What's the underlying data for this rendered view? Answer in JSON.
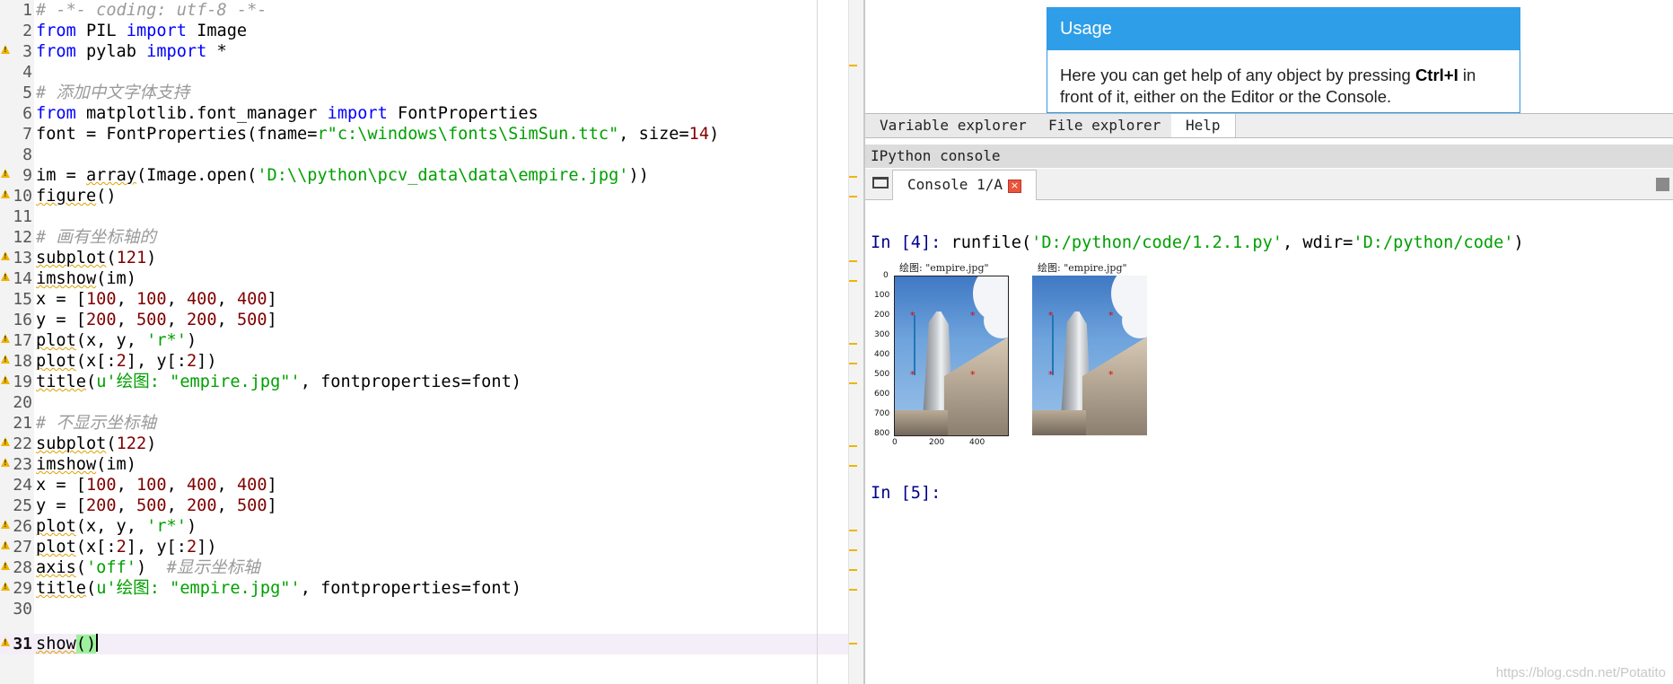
{
  "editor": {
    "lines": [
      {
        "n": "1",
        "w": false,
        "cur": false
      },
      {
        "n": "2",
        "w": false,
        "cur": false
      },
      {
        "n": "3",
        "w": true,
        "cur": false
      },
      {
        "n": "4",
        "w": false,
        "cur": false
      },
      {
        "n": "5",
        "w": false,
        "cur": false
      },
      {
        "n": "6",
        "w": false,
        "cur": false
      },
      {
        "n": "7",
        "w": false,
        "cur": false
      },
      {
        "n": "8",
        "w": false,
        "cur": false
      },
      {
        "n": "9",
        "w": true,
        "cur": false
      },
      {
        "n": "10",
        "w": true,
        "cur": false
      },
      {
        "n": "11",
        "w": false,
        "cur": false
      },
      {
        "n": "12",
        "w": false,
        "cur": false
      },
      {
        "n": "13",
        "w": true,
        "cur": false
      },
      {
        "n": "14",
        "w": true,
        "cur": false
      },
      {
        "n": "15",
        "w": false,
        "cur": false
      },
      {
        "n": "16",
        "w": false,
        "cur": false
      },
      {
        "n": "17",
        "w": true,
        "cur": false
      },
      {
        "n": "18",
        "w": true,
        "cur": false
      },
      {
        "n": "19",
        "w": true,
        "cur": false
      },
      {
        "n": "20",
        "w": false,
        "cur": false
      },
      {
        "n": "21",
        "w": false,
        "cur": false
      },
      {
        "n": "22",
        "w": true,
        "cur": false
      },
      {
        "n": "23",
        "w": true,
        "cur": false
      },
      {
        "n": "24",
        "w": false,
        "cur": false
      },
      {
        "n": "25",
        "w": false,
        "cur": false
      },
      {
        "n": "26",
        "w": true,
        "cur": false
      },
      {
        "n": "27",
        "w": true,
        "cur": false
      },
      {
        "n": "28",
        "w": true,
        "cur": false
      },
      {
        "n": "29",
        "w": true,
        "cur": false
      },
      {
        "n": "30",
        "w": false,
        "cur": false
      },
      {
        "n": "31",
        "w": true,
        "cur": true
      }
    ],
    "code": {
      "l1": "# -*- coding: utf-8 -*-",
      "l2_kw1": "from",
      "l2_a": " PIL ",
      "l2_kw2": "import",
      "l2_b": " Image",
      "l3_kw1": "from",
      "l3_a": " pylab ",
      "l3_kw2": "import",
      "l3_b": " *",
      "l5": "# 添加中文字体支持",
      "l6_kw1": "from",
      "l6_a": " matplotlib.font_manager ",
      "l6_kw2": "import",
      "l6_b": " FontProperties",
      "l7_a": "font = FontProperties(fname=",
      "l7_s1": "r\"c:\\windows\\fonts\\SimSun.ttc\"",
      "l7_b": ", size=",
      "l7_n": "14",
      "l7_c": ")",
      "l9_a": "im = ",
      "l9_fn": "array",
      "l9_b": "(Image.open(",
      "l9_s": "'D:\\\\python\\pcv_data\\data\\empire.jpg'",
      "l9_c": "))",
      "l10_fn": "figure",
      "l10_a": "()",
      "l12": "# 画有坐标轴的",
      "l13_fn": "subplot",
      "l13_a": "(",
      "l13_n": "121",
      "l13_b": ")",
      "l14_fn": "imshow",
      "l14_a": "(im)",
      "l15_a": "x = [",
      "l15_n1": "100",
      "l15_s1": ", ",
      "l15_n2": "100",
      "l15_s2": ", ",
      "l15_n3": "400",
      "l15_s3": ", ",
      "l15_n4": "400",
      "l15_b": "]",
      "l16_a": "y = [",
      "l16_n1": "200",
      "l16_s1": ", ",
      "l16_n2": "500",
      "l16_s2": ", ",
      "l16_n3": "200",
      "l16_s3": ", ",
      "l16_n4": "500",
      "l16_b": "]",
      "l17_fn": "plot",
      "l17_a": "(x, y, ",
      "l17_s": "'r*'",
      "l17_b": ")",
      "l18_fn": "plot",
      "l18_a": "(x[:",
      "l18_n1": "2",
      "l18_b": "], y[:",
      "l18_n2": "2",
      "l18_c": "])",
      "l19_fn": "title",
      "l19_a": "(",
      "l19_s": "u'绘图: \"empire.jpg\"'",
      "l19_b": ", fontproperties=font)",
      "l21": "# 不显示坐标轴",
      "l22_fn": "subplot",
      "l22_a": "(",
      "l22_n": "122",
      "l22_b": ")",
      "l23_fn": "imshow",
      "l23_a": "(im)",
      "l24_a": "x = [",
      "l24_n1": "100",
      "l24_s1": ", ",
      "l24_n2": "100",
      "l24_s2": ", ",
      "l24_n3": "400",
      "l24_s3": ", ",
      "l24_n4": "400",
      "l24_b": "]",
      "l25_a": "y = [",
      "l25_n1": "200",
      "l25_s1": ", ",
      "l25_n2": "500",
      "l25_s2": ", ",
      "l25_n3": "200",
      "l25_s3": ", ",
      "l25_n4": "500",
      "l25_b": "]",
      "l26_fn": "plot",
      "l26_a": "(x, y, ",
      "l26_s": "'r*'",
      "l26_b": ")",
      "l27_fn": "plot",
      "l27_a": "(x[:",
      "l27_n1": "2",
      "l27_b": "], y[:",
      "l27_n2": "2",
      "l27_c": "])",
      "l28_fn": "axis",
      "l28_a": "(",
      "l28_s": "'off'",
      "l28_b": ")  ",
      "l28_cm": "#显示坐标轴",
      "l29_fn": "title",
      "l29_a": "(",
      "l29_s": "u'绘图: \"empire.jpg\"'",
      "l29_b": ", fontproperties=font)",
      "l31_fn": "show",
      "l31_a": "()"
    }
  },
  "help": {
    "usage_title": "Usage",
    "usage_pre": "Here you can get help of any object by pressing ",
    "usage_key": "Ctrl+I",
    "usage_post": " in front of it, either on the Editor or the Console.",
    "tabs": [
      "Variable explorer",
      "File explorer",
      "Help"
    ],
    "active_tab": "Help"
  },
  "console": {
    "pane_title": "IPython console",
    "tab_label": "Console 1/A",
    "close_glyph": "×",
    "in4_prompt": "In [",
    "in4_num": "4",
    "in4_end": "]: ",
    "in4_a": "runfile(",
    "in4_s1": "'D:/python/code/1.2.1.py'",
    "in4_b": ", wdir=",
    "in4_s2": "'D:/python/code'",
    "in4_c": ")",
    "in5_prompt": "In [",
    "in5_num": "5",
    "in5_end": "]:",
    "figures": [
      {
        "title": "绘图: \"empire.jpg\"",
        "axes": true
      },
      {
        "title": "绘图: \"empire.jpg\"",
        "axes": false
      }
    ],
    "y_ticks": [
      "0",
      "100",
      "200",
      "300",
      "400",
      "500",
      "600",
      "700",
      "800"
    ],
    "x_ticks": [
      "0",
      "200",
      "400"
    ],
    "plot_points": {
      "x": [
        100,
        100,
        400,
        400
      ],
      "y": [
        200,
        500,
        200,
        500
      ],
      "line_x": [
        100,
        100
      ],
      "line_y": [
        200,
        500
      ]
    }
  },
  "watermark": "https://blog.csdn.net/Potatito"
}
